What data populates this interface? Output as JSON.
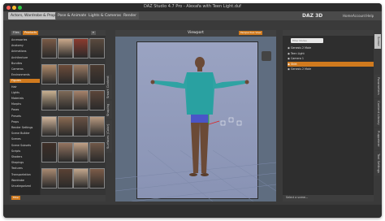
{
  "window": {
    "title": "DAZ Studio 4.7 Pro - Alexafa with Teen Light.duf",
    "traffic_lights": [
      "#ff5f57",
      "#febc2e",
      "#28c840"
    ]
  },
  "tabs": [
    {
      "label": "Actors, Wardrobe & Props",
      "active": true
    },
    {
      "label": "Pose & Animate",
      "active": false
    },
    {
      "label": "Lights & Cameras",
      "active": false
    },
    {
      "label": "Render",
      "active": false
    }
  ],
  "brand": {
    "logo": "DAZ 3D"
  },
  "header_menu": [
    "Home",
    "Account",
    "Help"
  ],
  "left_panel": {
    "header_buttons": [
      "Files",
      "Products"
    ],
    "categories": [
      {
        "label": "Accessories",
        "selected": false
      },
      {
        "label": "Anatomy",
        "selected": false
      },
      {
        "label": "Animations",
        "selected": false
      },
      {
        "label": "Architecture",
        "selected": false
      },
      {
        "label": "Bundles",
        "selected": false
      },
      {
        "label": "Cameras",
        "selected": false
      },
      {
        "label": "Environments",
        "selected": false
      },
      {
        "label": "Figures",
        "selected": true
      },
      {
        "label": "Hair",
        "selected": false
      },
      {
        "label": "Lights",
        "selected": false
      },
      {
        "label": "Materials",
        "selected": false
      },
      {
        "label": "Morphs",
        "selected": false
      },
      {
        "label": "Poses",
        "selected": false
      },
      {
        "label": "Presets",
        "selected": false
      },
      {
        "label": "Props",
        "selected": false
      },
      {
        "label": "Render Settings",
        "selected": false
      },
      {
        "label": "Scene Builder",
        "selected": false
      },
      {
        "label": "Scenes",
        "selected": false
      },
      {
        "label": "Scene Subsets",
        "selected": false
      },
      {
        "label": "Scripts",
        "selected": false
      },
      {
        "label": "Shaders",
        "selected": false
      },
      {
        "label": "Shapings",
        "selected": false
      },
      {
        "label": "Textures",
        "selected": false
      },
      {
        "label": "Transportation",
        "selected": false
      },
      {
        "label": "Wardrobe",
        "selected": false
      },
      {
        "label": "Uncategorized",
        "selected": false
      }
    ],
    "footer_button": "Filter",
    "side_tabs": [
      "Smart Content",
      "Shaping",
      "Surfaces (Color)"
    ]
  },
  "viewport": {
    "label": "Viewport",
    "right_button": "Perspective View"
  },
  "right_panel": {
    "search_placeholder": "Filter Nodes",
    "scene_items": [
      {
        "label": "Genesis 2 Male",
        "selected": false
      },
      {
        "label": "Teen Light",
        "selected": false
      },
      {
        "label": "Camera 1",
        "selected": false
      },
      {
        "label": "Shirt",
        "selected": true
      },
      {
        "label": "Genesis 2 Male",
        "selected": false
      }
    ],
    "side_tabs": [
      "Scene",
      "Parameters",
      "Content Library",
      "Puppeteer",
      "Tool Settings"
    ],
    "footer_text": "Select a scene..."
  }
}
